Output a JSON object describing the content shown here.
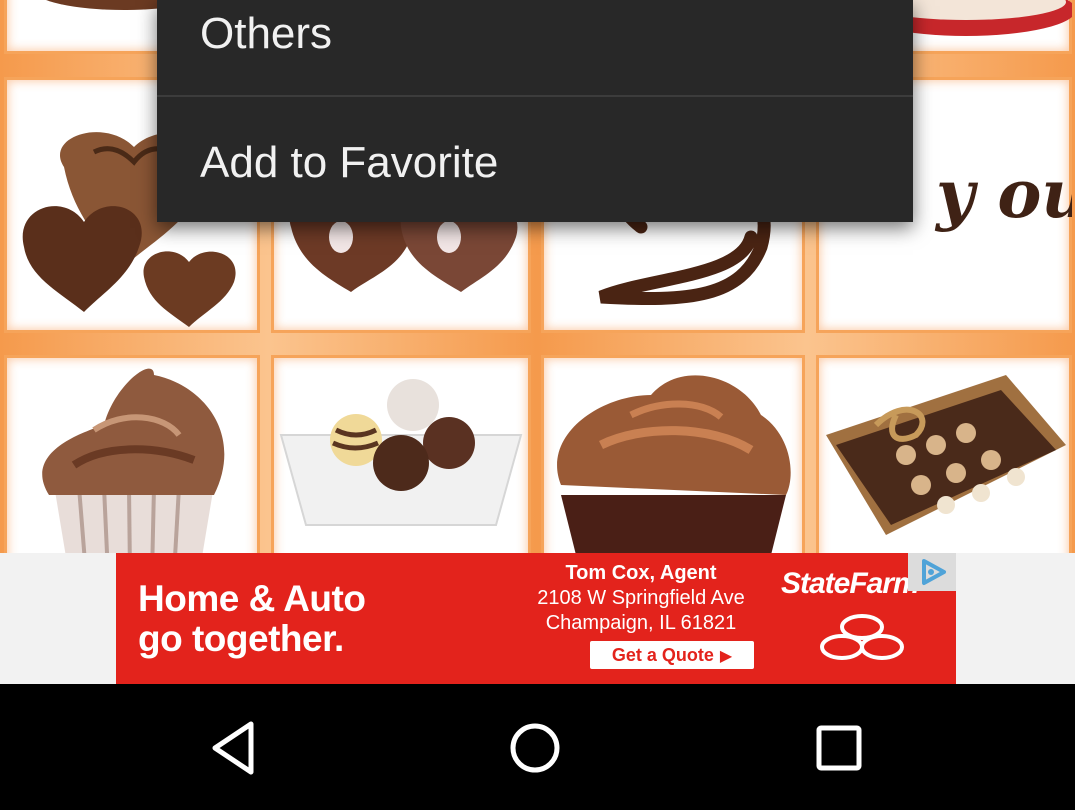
{
  "menu": {
    "items": [
      {
        "label": "Others"
      },
      {
        "label": "Add to Favorite"
      }
    ]
  },
  "grid": {
    "stickers": [
      {
        "icon": "chocolate-hearts-love-icon"
      },
      {
        "icon": "heart-candies-icon"
      },
      {
        "icon": "chocolate-heart-outline-icon"
      },
      {
        "icon": "chocolate-you-text-icon"
      },
      {
        "icon": "cupcake-icon"
      },
      {
        "icon": "truffles-plate-icon"
      },
      {
        "icon": "chocolate-muffin-icon"
      },
      {
        "icon": "chocolate-box-icon"
      }
    ],
    "partial_lettering_row2_col4": "y ou"
  },
  "ad": {
    "headline_line1": "Home & Auto",
    "headline_line2": "go together.",
    "agent_name": "Tom Cox, Agent",
    "address_line1": "2108 W Springfield Ave",
    "address_line2": "Champaign, IL 61821",
    "cta": "Get a Quote",
    "brand": "StateFarm",
    "colors": {
      "background": "#e3231c",
      "text": "#ffffff"
    }
  },
  "navbar": {
    "back": "back-icon",
    "home": "home-icon",
    "recents": "recents-icon"
  }
}
